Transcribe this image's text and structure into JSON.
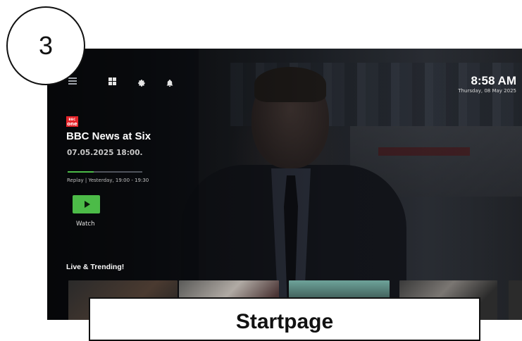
{
  "step": {
    "number": "3"
  },
  "caption": {
    "text": "Startpage"
  },
  "clock": {
    "time": "8:58 AM",
    "date": "Thursday, 08 May 2025"
  },
  "nav": {
    "icons": [
      "menu-icon",
      "grid-icon",
      "gear-icon",
      "bell-icon"
    ]
  },
  "channel": {
    "logo_line1": "BBC",
    "logo_line2": "one",
    "logo_color": "#e5242a"
  },
  "program": {
    "title": "BBC News at Six",
    "datetime": "07.05.2025 18:00.",
    "replay_info": "Replay  |  Yesterday, 19:00 - 19:30",
    "progress": 0.35,
    "watch_label": "Watch"
  },
  "accent_color": "#4cbb48",
  "section": {
    "title": "Live & Trending!"
  }
}
